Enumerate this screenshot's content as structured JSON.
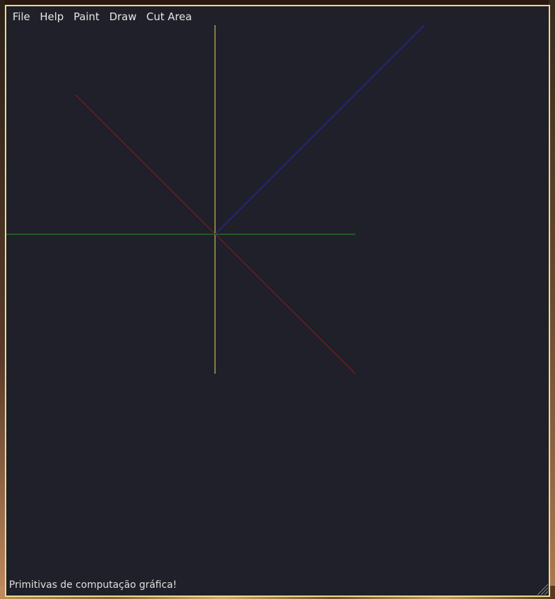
{
  "menubar": {
    "items": [
      {
        "label": "File"
      },
      {
        "label": "Help"
      },
      {
        "label": "Paint"
      },
      {
        "label": "Draw"
      },
      {
        "label": "Cut Area"
      }
    ]
  },
  "canvas": {
    "background": "#1f2029",
    "lines": [
      {
        "name": "yellow-vertical-line",
        "color": "#e6e05a"
      },
      {
        "name": "green-horizontal-line",
        "color": "#2f8f2f"
      },
      {
        "name": "red-diagonal-line",
        "color": "#8a1a1a"
      },
      {
        "name": "blue-diagonal-line",
        "color": "#26267a"
      }
    ]
  },
  "status": {
    "text": "Primitivas de computação gráfica!"
  },
  "colors": {
    "window_border": "#e8e08a",
    "window_bg": "#1f2029",
    "text": "#e6e6e6"
  }
}
